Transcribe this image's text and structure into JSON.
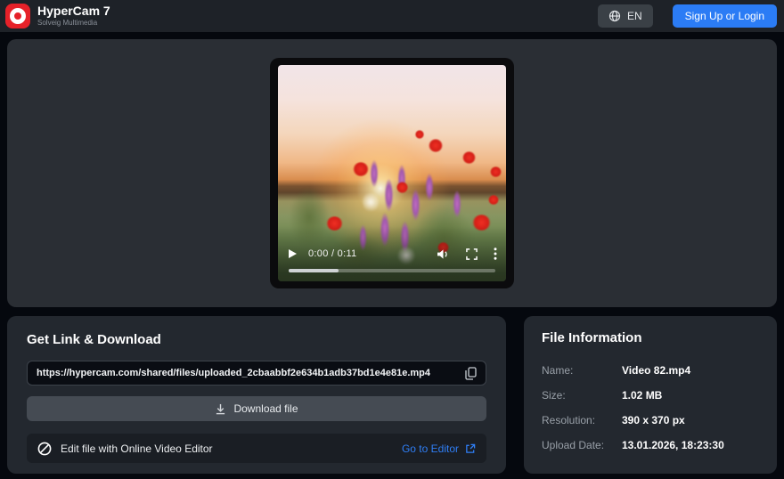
{
  "header": {
    "app_title": "HyperCam 7",
    "app_subtitle": "Solveig Multimedia",
    "language_label": "EN",
    "signup_label": "Sign Up or Login"
  },
  "player": {
    "time_display": "0:00 / 0:11",
    "progress_percent": 24
  },
  "download_panel": {
    "title": "Get Link & Download",
    "share_url": "https://hypercam.com/shared/files/uploaded_2cbaabbf2e634b1adb37bd1e4e81e.mp4",
    "download_label": "Download file",
    "edit_label": "Edit file with Online Video Editor",
    "editor_link_label": "Go to Editor"
  },
  "file_info": {
    "title": "File Information",
    "rows": [
      {
        "label": "Name:",
        "value": "Video 82.mp4"
      },
      {
        "label": "Size:",
        "value": "1.02 MB"
      },
      {
        "label": "Resolution:",
        "value": "390 x 370 px"
      },
      {
        "label": "Upload Date:",
        "value": "13.01.2026, 18:23:30"
      }
    ]
  },
  "icons": {
    "logo": "record-ring",
    "language": "globe-icon",
    "copy": "copy-icon",
    "download": "download-arrow-icon",
    "editor": "editor-logo-icon",
    "external": "external-link-icon",
    "play": "play-icon",
    "volume": "volume-icon",
    "fullscreen": "fullscreen-icon",
    "menu": "kebab-menu-icon"
  },
  "colors": {
    "accent_blue": "#2b7cf5",
    "link_blue": "#2f7ef5",
    "logo_red": "#e62129",
    "panel": "#23282f",
    "main_panel": "#2a2e34",
    "header": "#1e2228"
  }
}
